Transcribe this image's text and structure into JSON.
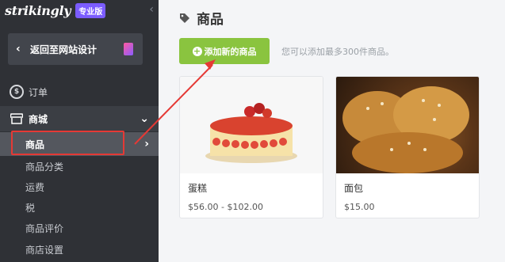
{
  "sidebar": {
    "logo_text": "strikingly",
    "badge": "专业版",
    "back_label": "返回至网站设计",
    "orders_label": "订单",
    "shop_label": "商城",
    "items": [
      {
        "label": "商品"
      },
      {
        "label": "商品分类"
      },
      {
        "label": "运费"
      },
      {
        "label": "税"
      },
      {
        "label": "商品评价"
      },
      {
        "label": "商店设置"
      }
    ]
  },
  "main": {
    "title": "商品",
    "add_button_label": "添加新的商品",
    "hint": "您可以添加最多300件商品。",
    "products": [
      {
        "name": "蛋糕",
        "price": "$56.00 - $102.00"
      },
      {
        "name": "面包",
        "price": "$15.00"
      }
    ]
  },
  "colors": {
    "sidebar_bg": "#2f3136",
    "accent_green": "#8ac43f",
    "pro_badge": "#7b5cff",
    "highlight_red": "#e53935"
  }
}
